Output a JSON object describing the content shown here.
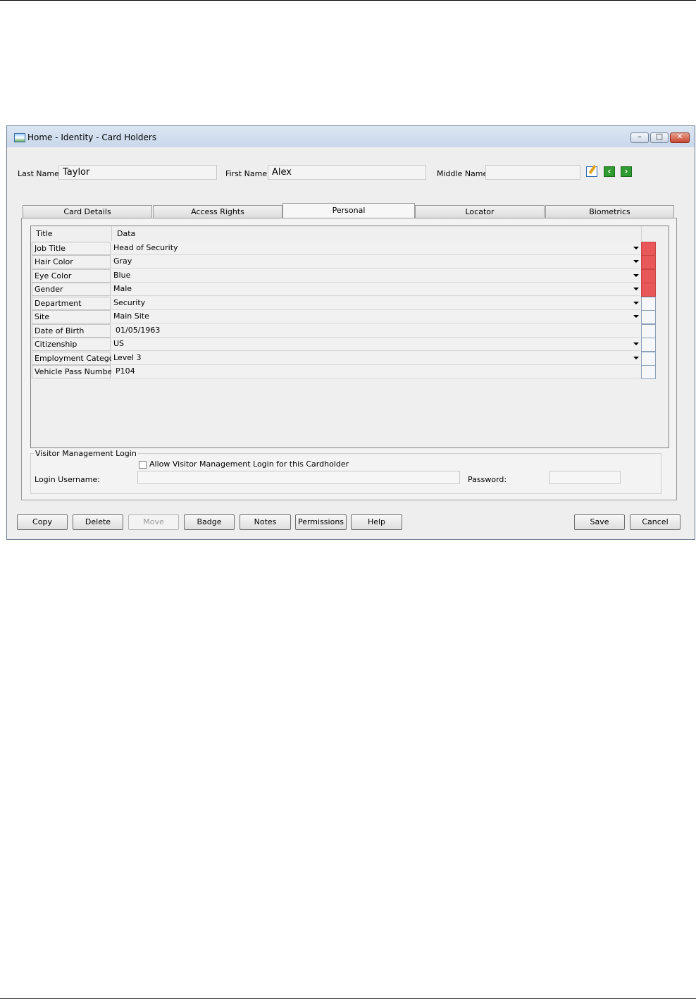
{
  "window": {
    "title": "Home - Identity - Card Holders",
    "controls": {
      "minimize": "–",
      "maximize": "□",
      "close": "✕"
    }
  },
  "name_fields": {
    "last_name_label": "Last Name:",
    "last_name_value": "Taylor",
    "first_name_label": "First Name:",
    "first_name_value": "Alex",
    "middle_name_label": "Middle Name:",
    "middle_name_value": ""
  },
  "toolbar_icons": [
    "edit-icon",
    "previous-arrow-icon",
    "next-arrow-icon"
  ],
  "tabs": [
    {
      "label": "Card Details"
    },
    {
      "label": "Access Rights"
    },
    {
      "label": "Personal",
      "active": true
    },
    {
      "label": "Locator"
    },
    {
      "label": "Biometrics"
    }
  ],
  "grid": {
    "headers": {
      "title": "Title",
      "data": "Data"
    },
    "rows": [
      {
        "title": "Job Title",
        "data": "Head of Security",
        "dropdown": true,
        "required": true
      },
      {
        "title": "Hair Color",
        "data": "Gray",
        "dropdown": true,
        "required": true
      },
      {
        "title": "Eye Color",
        "data": "Blue",
        "dropdown": true,
        "required": true
      },
      {
        "title": "Gender",
        "data": "Male",
        "dropdown": true,
        "required": true
      },
      {
        "title": "Department",
        "data": "Security",
        "dropdown": true,
        "required": false
      },
      {
        "title": "Site",
        "data": "Main Site",
        "dropdown": true,
        "required": false
      },
      {
        "title": "Date of Birth",
        "data": "01/05/1963",
        "dropdown": false,
        "required": false
      },
      {
        "title": "Citizenship",
        "data": "US",
        "dropdown": true,
        "required": false
      },
      {
        "title": "Employment Category",
        "data": "Level 3",
        "dropdown": true,
        "required": false
      },
      {
        "title": "Vehicle Pass Number",
        "data": "P104",
        "dropdown": false,
        "required": false
      }
    ],
    "required_color": "#e85858"
  },
  "visitor_login": {
    "group_title": "Visitor Management Login",
    "checkbox_label": "Allow Visitor Management Login for this Cardholder",
    "checkbox_checked": false,
    "username_label": "Login Username:",
    "username_value": "",
    "password_label": "Password:",
    "password_value": ""
  },
  "buttons": {
    "copy": "Copy",
    "delete": "Delete",
    "move": "Move",
    "badge": "Badge",
    "notes": "Notes",
    "permissions": "Permissions",
    "help": "Help",
    "save": "Save",
    "cancel": "Cancel"
  }
}
